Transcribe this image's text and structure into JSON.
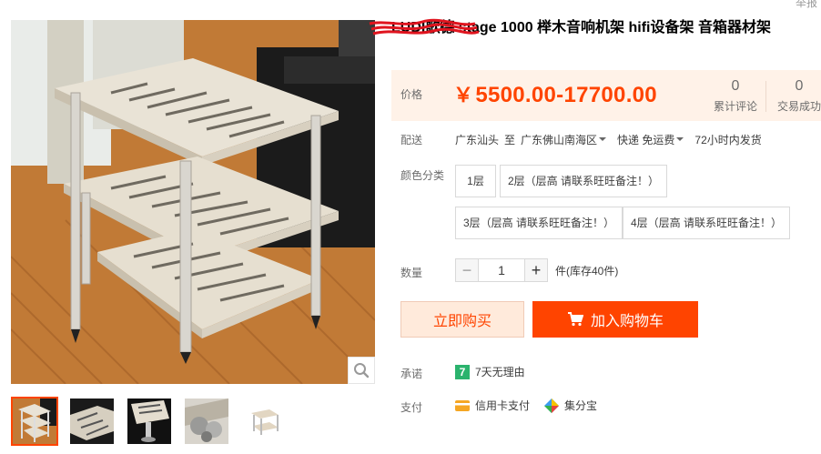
{
  "header": {
    "report_label": "举报"
  },
  "product": {
    "title": "LUDI歌德 stage 1000 榉木音响机架 hifi设备架 音箱器材架"
  },
  "price": {
    "label": "价格",
    "currency": "￥",
    "range": "5500.00-17700.00",
    "reviews_count": "0",
    "reviews_label": "累计评论",
    "deals_count": "0",
    "deals_label": "交易成功"
  },
  "shipping": {
    "label": "配送",
    "from": "广东汕头",
    "to_word": "至",
    "destination": "广东佛山南海区",
    "method": "快递 免运费",
    "dispatch": "72小时内发货"
  },
  "color": {
    "label": "颜色分类",
    "options": [
      "1层",
      "2层（层高 请联系旺旺备注！）",
      "3层（层高 请联系旺旺备注！）",
      "4层（层高 请联系旺旺备注！）"
    ]
  },
  "quantity": {
    "label": "数量",
    "minus": "−",
    "value": "1",
    "plus": "+",
    "stock": "件(库存40件)"
  },
  "actions": {
    "buy_now": "立即购买",
    "add_to_cart": "加入购物车"
  },
  "promise": {
    "label": "承诺",
    "badge": "7",
    "text": "7天无理由"
  },
  "payment": {
    "label": "支付",
    "methods": [
      "信用卡支付",
      "集分宝"
    ]
  },
  "colors": {
    "accent": "#ff4400",
    "price_bg": "#fff2e8",
    "buy_bg": "#ffeadb",
    "promise_green": "#2bb36d"
  },
  "icons": {
    "zoom": "magnifier-icon",
    "cart": "cart-icon",
    "credit_card": "credit-card-icon",
    "jifenbao": "jifenbao-icon"
  }
}
